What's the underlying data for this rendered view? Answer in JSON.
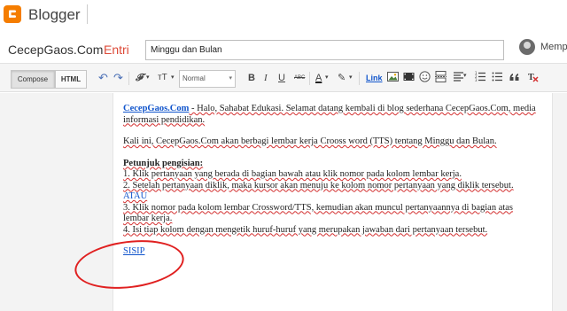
{
  "app": {
    "brand": "Blogger"
  },
  "titlebar": {
    "blog_name": "CecepGaos.Com",
    "separator": "·",
    "entry_label": "Entri",
    "post_title": "Minggu dan Bulan",
    "user_name": "Mempos"
  },
  "toolbar": {
    "compose": "Compose",
    "html": "HTML",
    "undo_icon": "↶",
    "redo_icon": "↷",
    "font_icon": "𝓕",
    "font_caret": "▾",
    "size_icon": "ᴛT",
    "size_caret": "▾",
    "format_value": "Normal",
    "format_caret": "▾",
    "bold": "B",
    "italic": "I",
    "underline": "U",
    "strike": "ABC",
    "text_color": "A",
    "text_color_caret": "▾",
    "highlight": "✎",
    "highlight_caret": "▾",
    "link": "Link",
    "accent_color": "#1155cc"
  },
  "content": {
    "line1_link": "CecepGaos.Com",
    "line1_text": " - Halo, Sahabat Edukasi. Selamat datang kembali di blog sederhana CecepGaos.Com, media informasi pendidikan.",
    "para2": "Kali ini, CecepGaos.Com akan berbagi lembar kerja Crooss word (TTS) tentang Minggu dan Bulan.",
    "heading": "Petunjuk pengisian:",
    "step1": "1. Klik pertanyaan yang berada di bagian bawah atau klik nomor pada kolom lembar kerja.",
    "step2": "2. Setelah pertanyaan diklik, maka kursor akan menuju ke kolom nomor pertanyaan yang diklik tersebut.",
    "atau": "ATAU",
    "step3": "3. Klik nomor pada kolom lembar Crossword/TTS, kemudian akan muncul pertanyaannya di bagian atas lembar kerja.",
    "step4": "4. Isi tiap kolom dengan mengetik huruf-huruf yang merupakan jawaban dari pertanyaan tersebut.",
    "sisip": "SISIP"
  },
  "annotation": {
    "circle_color": "#e02020"
  }
}
